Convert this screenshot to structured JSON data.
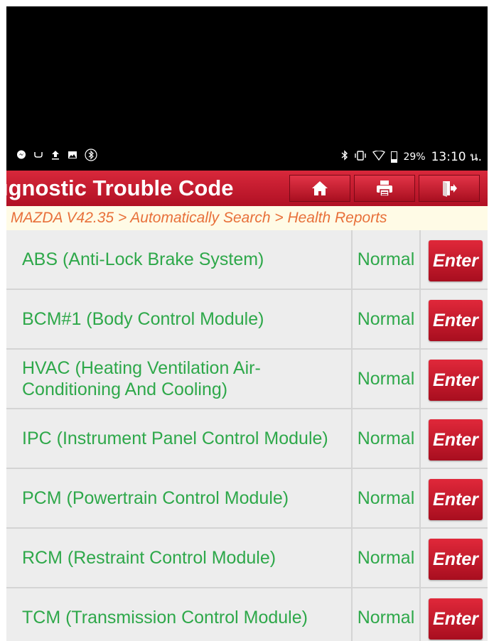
{
  "status_bar": {
    "left_icons": [
      "messenger-icon",
      "usb-debug-icon",
      "upload-icon",
      "image-icon",
      "bluetooth-settings-icon"
    ],
    "right_icons": [
      "bluetooth-icon",
      "vibrate-icon",
      "wifi-icon",
      "battery-icon"
    ],
    "battery_percent": "29%",
    "time": "13:10 น."
  },
  "header": {
    "title": "ıgnostic Trouble Code",
    "buttons": [
      "home-icon",
      "print-icon",
      "exit-icon"
    ]
  },
  "breadcrumb": "MAZDA V42.35 > Automatically Search > Health Reports",
  "modules": [
    {
      "name": "ABS (Anti-Lock Brake System)",
      "status": "Normal",
      "action": "Enter"
    },
    {
      "name": "BCM#1 (Body Control Module)",
      "status": "Normal",
      "action": "Enter"
    },
    {
      "name": "HVAC (Heating Ventilation Air-Conditioning And Cooling)",
      "status": "Normal",
      "action": "Enter"
    },
    {
      "name": "IPC (Instrument Panel Control Module)",
      "status": "Normal",
      "action": "Enter"
    },
    {
      "name": "PCM (Powertrain Control Module)",
      "status": "Normal",
      "action": "Enter"
    },
    {
      "name": "RCM (Restraint Control Module)",
      "status": "Normal",
      "action": "Enter"
    },
    {
      "name": "TCM (Transmission Control Module)",
      "status": "Normal",
      "action": "Enter"
    }
  ],
  "colors": {
    "header_red": "#c41a2e",
    "module_green": "#2ea84a",
    "breadcrumb_orange": "#e8703a"
  }
}
